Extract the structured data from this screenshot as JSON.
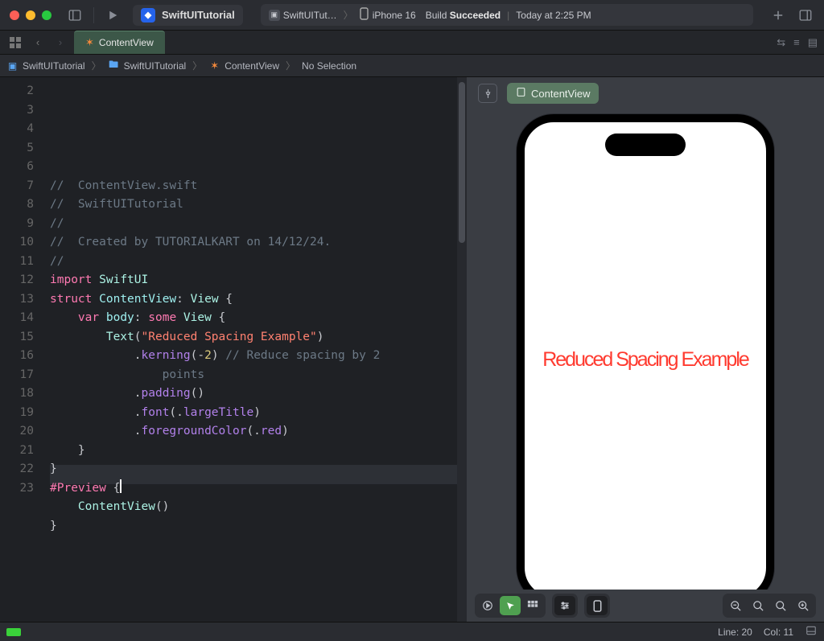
{
  "window": {
    "scheme_name": "SwiftUITutorial",
    "scheme_file": "SwiftUITut…",
    "device": "iPhone 16",
    "build_label": "Build",
    "build_status": "Succeeded",
    "build_time": "Today at 2:25 PM"
  },
  "tabs": {
    "active": "ContentView"
  },
  "breadcrumb": {
    "project": "SwiftUITutorial",
    "folder": "SwiftUITutorial",
    "file": "ContentView",
    "selection": "No Selection"
  },
  "code": {
    "lines": [
      {
        "n": 2,
        "segs": [
          {
            "c": "tok-comment",
            "t": "//  ContentView.swift"
          }
        ]
      },
      {
        "n": 3,
        "segs": [
          {
            "c": "tok-comment",
            "t": "//  SwiftUITutorial"
          }
        ]
      },
      {
        "n": 4,
        "segs": [
          {
            "c": "tok-comment",
            "t": "//"
          }
        ]
      },
      {
        "n": 5,
        "segs": [
          {
            "c": "tok-comment",
            "t": "//  Created by TUTORIALKART on 14/12/24."
          }
        ]
      },
      {
        "n": 6,
        "segs": [
          {
            "c": "tok-comment",
            "t": "//"
          }
        ]
      },
      {
        "n": 7,
        "segs": [
          {
            "c": "",
            "t": ""
          }
        ]
      },
      {
        "n": 8,
        "segs": [
          {
            "c": "tok-keyword",
            "t": "import"
          },
          {
            "c": "",
            "t": " "
          },
          {
            "c": "tok-type",
            "t": "SwiftUI"
          }
        ]
      },
      {
        "n": 9,
        "segs": [
          {
            "c": "",
            "t": ""
          }
        ]
      },
      {
        "n": 10,
        "segs": [
          {
            "c": "tok-keyword",
            "t": "struct"
          },
          {
            "c": "",
            "t": " "
          },
          {
            "c": "tok-ident",
            "t": "ContentView"
          },
          {
            "c": "",
            "t": ": "
          },
          {
            "c": "tok-type",
            "t": "View"
          },
          {
            "c": "",
            "t": " {"
          }
        ]
      },
      {
        "n": 11,
        "segs": [
          {
            "c": "",
            "t": "    "
          },
          {
            "c": "tok-keyword",
            "t": "var"
          },
          {
            "c": "",
            "t": " "
          },
          {
            "c": "tok-ident",
            "t": "body"
          },
          {
            "c": "",
            "t": ": "
          },
          {
            "c": "tok-keyword",
            "t": "some"
          },
          {
            "c": "",
            "t": " "
          },
          {
            "c": "tok-type",
            "t": "View"
          },
          {
            "c": "",
            "t": " {"
          }
        ]
      },
      {
        "n": 12,
        "segs": [
          {
            "c": "",
            "t": "        "
          },
          {
            "c": "tok-type",
            "t": "Text"
          },
          {
            "c": "",
            "t": "("
          },
          {
            "c": "tok-string",
            "t": "\"Reduced Spacing Example\""
          },
          {
            "c": "",
            "t": ")"
          }
        ]
      },
      {
        "n": 13,
        "segs": [
          {
            "c": "",
            "t": "            ."
          },
          {
            "c": "tok-func",
            "t": "kerning"
          },
          {
            "c": "",
            "t": "(-"
          },
          {
            "c": "tok-number",
            "t": "2"
          },
          {
            "c": "",
            "t": ") "
          },
          {
            "c": "tok-comment",
            "t": "// Reduce spacing by 2 "
          }
        ]
      },
      {
        "n": "",
        "segs": [
          {
            "c": "tok-comment",
            "t": "                points"
          }
        ]
      },
      {
        "n": 14,
        "segs": [
          {
            "c": "",
            "t": "            ."
          },
          {
            "c": "tok-func",
            "t": "padding"
          },
          {
            "c": "",
            "t": "()"
          }
        ]
      },
      {
        "n": 15,
        "segs": [
          {
            "c": "",
            "t": "            ."
          },
          {
            "c": "tok-func",
            "t": "font"
          },
          {
            "c": "",
            "t": "(."
          },
          {
            "c": "tok-enum",
            "t": "largeTitle"
          },
          {
            "c": "",
            "t": ")"
          }
        ]
      },
      {
        "n": 16,
        "segs": [
          {
            "c": "",
            "t": "            ."
          },
          {
            "c": "tok-func",
            "t": "foregroundColor"
          },
          {
            "c": "",
            "t": "(."
          },
          {
            "c": "tok-enum",
            "t": "red"
          },
          {
            "c": "",
            "t": ")"
          }
        ]
      },
      {
        "n": 17,
        "segs": [
          {
            "c": "",
            "t": "    }"
          }
        ]
      },
      {
        "n": 18,
        "segs": [
          {
            "c": "",
            "t": "}"
          }
        ]
      },
      {
        "n": 19,
        "segs": [
          {
            "c": "",
            "t": ""
          }
        ]
      },
      {
        "n": 20,
        "segs": [
          {
            "c": "tok-preview",
            "t": "#Preview"
          },
          {
            "c": "",
            "t": " {"
          }
        ],
        "cursor": true
      },
      {
        "n": 21,
        "segs": [
          {
            "c": "",
            "t": "    "
          },
          {
            "c": "tok-type",
            "t": "ContentView"
          },
          {
            "c": "",
            "t": "()"
          }
        ]
      },
      {
        "n": 22,
        "segs": [
          {
            "c": "",
            "t": "}"
          }
        ]
      },
      {
        "n": 23,
        "segs": [
          {
            "c": "",
            "t": ""
          }
        ]
      }
    ]
  },
  "preview": {
    "chip_label": "ContentView",
    "rendered_text": "Reduced Spacing Example"
  },
  "status": {
    "line": "Line: 20",
    "col": "Col: 11"
  }
}
